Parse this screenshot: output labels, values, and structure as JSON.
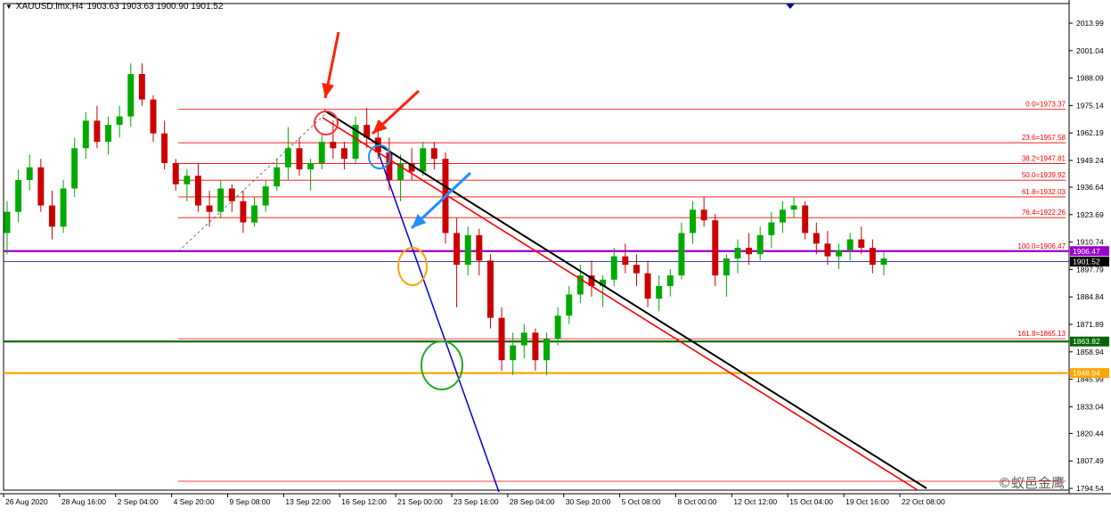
{
  "header": {
    "menu_icon": "triangle-down-icon",
    "symbol": "XAUUSD.lmx,H4",
    "ohlc": "1903.63 1903.63 1900.90 1901.52"
  },
  "watermark": "©蚁邑金鹰",
  "colors": {
    "bull": "#00aa00",
    "bear": "#cc0000",
    "fib": "#ff0000",
    "purple_line": "#9900cc",
    "price_line": "#000080",
    "green_level": "#006600",
    "orange_level": "#ffa500",
    "black_trend": "#000000",
    "red_trend": "#ff0000",
    "blue_trend": "#0000dd",
    "circle_red": "#ff3333",
    "circle_blue": "#1e90ff",
    "circle_orange": "#ffa500",
    "circle_green": "#22aa22",
    "arrow_red": "#ff2200",
    "arrow_blue": "#1e90ff"
  },
  "chart_data": {
    "type": "candlestick",
    "symbol": "XAUUSD.lmx",
    "timeframe": "H4",
    "ylim": [
      1794.54,
      2013.99
    ],
    "y_ticks": [
      "2013.99",
      "2001.04",
      "1988.09",
      "1975.14",
      "1962.19",
      "1949.24",
      "1936.64",
      "1923.69",
      "1910.74",
      "1897.79",
      "1884.84",
      "1871.89",
      "1858.94",
      "1845.99",
      "1833.04",
      "1820.44",
      "1807.49",
      "1794.54"
    ],
    "x_labels": [
      "26 Aug 2020",
      "28 Aug 16:00",
      "2 Sep 04:00",
      "4 Sep 20:00",
      "9 Sep 08:00",
      "13 Sep 22:00",
      "16 Sep 12:00",
      "21 Sep 00:00",
      "23 Sep 16:00",
      "28 Sep 04:00",
      "30 Sep 20:00",
      "5 Oct 08:00",
      "8 Oct 00:00",
      "12 Oct 12:00",
      "15 Oct 04:00",
      "19 Oct 16:00",
      "22 Oct 08:00"
    ],
    "fib_levels": [
      {
        "label": "0.0=1973.37",
        "price": 1973.37
      },
      {
        "label": "23.6=1957.58",
        "price": 1957.58
      },
      {
        "label": "38.2=1947.81",
        "price": 1947.81
      },
      {
        "label": "50.0=1939.92",
        "price": 1939.92
      },
      {
        "label": "61.8=1932.03",
        "price": 1932.03
      },
      {
        "label": "76.4=1922.26",
        "price": 1922.26
      },
      {
        "label": "100.0=1906.47",
        "price": 1906.47
      },
      {
        "label": "161.8=1865.13",
        "price": 1865.13
      }
    ],
    "horizontal_lines": [
      {
        "name": "purple-level",
        "label": "1906.47",
        "price": 1906.47
      },
      {
        "name": "current-price",
        "label": "1901.52",
        "price": 1901.52
      },
      {
        "name": "green-level",
        "label": "1863.82",
        "price": 1863.82
      },
      {
        "name": "orange-level",
        "label": "1848.94",
        "price": 1848.94
      }
    ],
    "candles": [
      [
        1915,
        1930,
        1905,
        1925
      ],
      [
        1925,
        1945,
        1920,
        1940
      ],
      [
        1940,
        1952,
        1935,
        1946
      ],
      [
        1946,
        1950,
        1925,
        1928
      ],
      [
        1928,
        1935,
        1912,
        1918
      ],
      [
        1918,
        1940,
        1915,
        1936
      ],
      [
        1936,
        1960,
        1932,
        1955
      ],
      [
        1955,
        1972,
        1950,
        1968
      ],
      [
        1968,
        1975,
        1955,
        1958
      ],
      [
        1958,
        1970,
        1952,
        1966
      ],
      [
        1966,
        1975,
        1960,
        1970
      ],
      [
        1970,
        1995,
        1965,
        1990
      ],
      [
        1990,
        1995,
        1975,
        1978
      ],
      [
        1978,
        1980,
        1958,
        1962
      ],
      [
        1962,
        1968,
        1945,
        1948
      ],
      [
        1948,
        1950,
        1935,
        1938
      ],
      [
        1938,
        1945,
        1930,
        1942
      ],
      [
        1942,
        1948,
        1925,
        1928
      ],
      [
        1928,
        1935,
        1918,
        1925
      ],
      [
        1925,
        1940,
        1922,
        1936
      ],
      [
        1936,
        1938,
        1925,
        1930
      ],
      [
        1930,
        1935,
        1915,
        1920
      ],
      [
        1920,
        1932,
        1918,
        1928
      ],
      [
        1928,
        1940,
        1925,
        1937
      ],
      [
        1937,
        1950,
        1935,
        1946
      ],
      [
        1946,
        1965,
        1940,
        1955
      ],
      [
        1955,
        1960,
        1942,
        1945
      ],
      [
        1945,
        1950,
        1935,
        1948
      ],
      [
        1948,
        1962,
        1945,
        1958
      ],
      [
        1958,
        1968,
        1950,
        1955
      ],
      [
        1955,
        1958,
        1945,
        1950
      ],
      [
        1950,
        1970,
        1948,
        1966
      ],
      [
        1966,
        1974,
        1955,
        1960
      ],
      [
        1960,
        1968,
        1950,
        1953
      ],
      [
        1953,
        1960,
        1935,
        1940
      ],
      [
        1940,
        1952,
        1930,
        1948
      ],
      [
        1948,
        1955,
        1940,
        1944
      ],
      [
        1944,
        1958,
        1942,
        1955
      ],
      [
        1955,
        1958,
        1945,
        1950
      ],
      [
        1950,
        1953,
        1910,
        1915
      ],
      [
        1915,
        1922,
        1880,
        1900
      ],
      [
        1900,
        1918,
        1895,
        1914
      ],
      [
        1914,
        1917,
        1895,
        1902
      ],
      [
        1902,
        1905,
        1870,
        1875
      ],
      [
        1875,
        1880,
        1850,
        1855
      ],
      [
        1855,
        1868,
        1848,
        1862
      ],
      [
        1862,
        1872,
        1856,
        1868
      ],
      [
        1868,
        1870,
        1850,
        1855
      ],
      [
        1855,
        1868,
        1848,
        1865
      ],
      [
        1865,
        1880,
        1862,
        1876
      ],
      [
        1876,
        1890,
        1872,
        1886
      ],
      [
        1886,
        1900,
        1882,
        1895
      ],
      [
        1895,
        1902,
        1885,
        1890
      ],
      [
        1890,
        1895,
        1880,
        1893
      ],
      [
        1893,
        1908,
        1890,
        1904
      ],
      [
        1904,
        1910,
        1896,
        1900
      ],
      [
        1900,
        1905,
        1890,
        1896
      ],
      [
        1896,
        1902,
        1880,
        1884
      ],
      [
        1884,
        1895,
        1878,
        1890
      ],
      [
        1890,
        1898,
        1885,
        1895
      ],
      [
        1895,
        1920,
        1893,
        1915
      ],
      [
        1915,
        1930,
        1910,
        1926
      ],
      [
        1926,
        1932,
        1918,
        1921
      ],
      [
        1921,
        1924,
        1890,
        1895
      ],
      [
        1895,
        1905,
        1885,
        1903
      ],
      [
        1903,
        1912,
        1896,
        1908
      ],
      [
        1908,
        1915,
        1900,
        1905
      ],
      [
        1905,
        1918,
        1902,
        1914
      ],
      [
        1914,
        1925,
        1908,
        1920
      ],
      [
        1920,
        1930,
        1915,
        1926
      ],
      [
        1926,
        1932,
        1922,
        1928
      ],
      [
        1928,
        1930,
        1912,
        1915
      ],
      [
        1915,
        1920,
        1905,
        1910
      ],
      [
        1910,
        1916,
        1900,
        1904
      ],
      [
        1904,
        1910,
        1898,
        1907
      ],
      [
        1907,
        1915,
        1902,
        1912
      ],
      [
        1912,
        1918,
        1905,
        1908
      ],
      [
        1908,
        1912,
        1896,
        1900
      ],
      [
        1900,
        1906,
        1895,
        1903
      ]
    ],
    "trend_lines": [
      {
        "name": "black-trendline",
        "from": [
          "16 Sep 12:00",
          1973.37
        ],
        "to": [
          "22 Oct 08:00",
          1794.54
        ]
      },
      {
        "name": "red-trendline",
        "from": [
          "16 Sep 12:00",
          1970
        ],
        "to": [
          "22 Oct 08:00",
          1794.54
        ]
      },
      {
        "name": "blue-trendline",
        "from": [
          "21 Sep 00:00",
          1950
        ],
        "to": [
          "28 Sep 04:00",
          1794.54
        ]
      }
    ]
  }
}
